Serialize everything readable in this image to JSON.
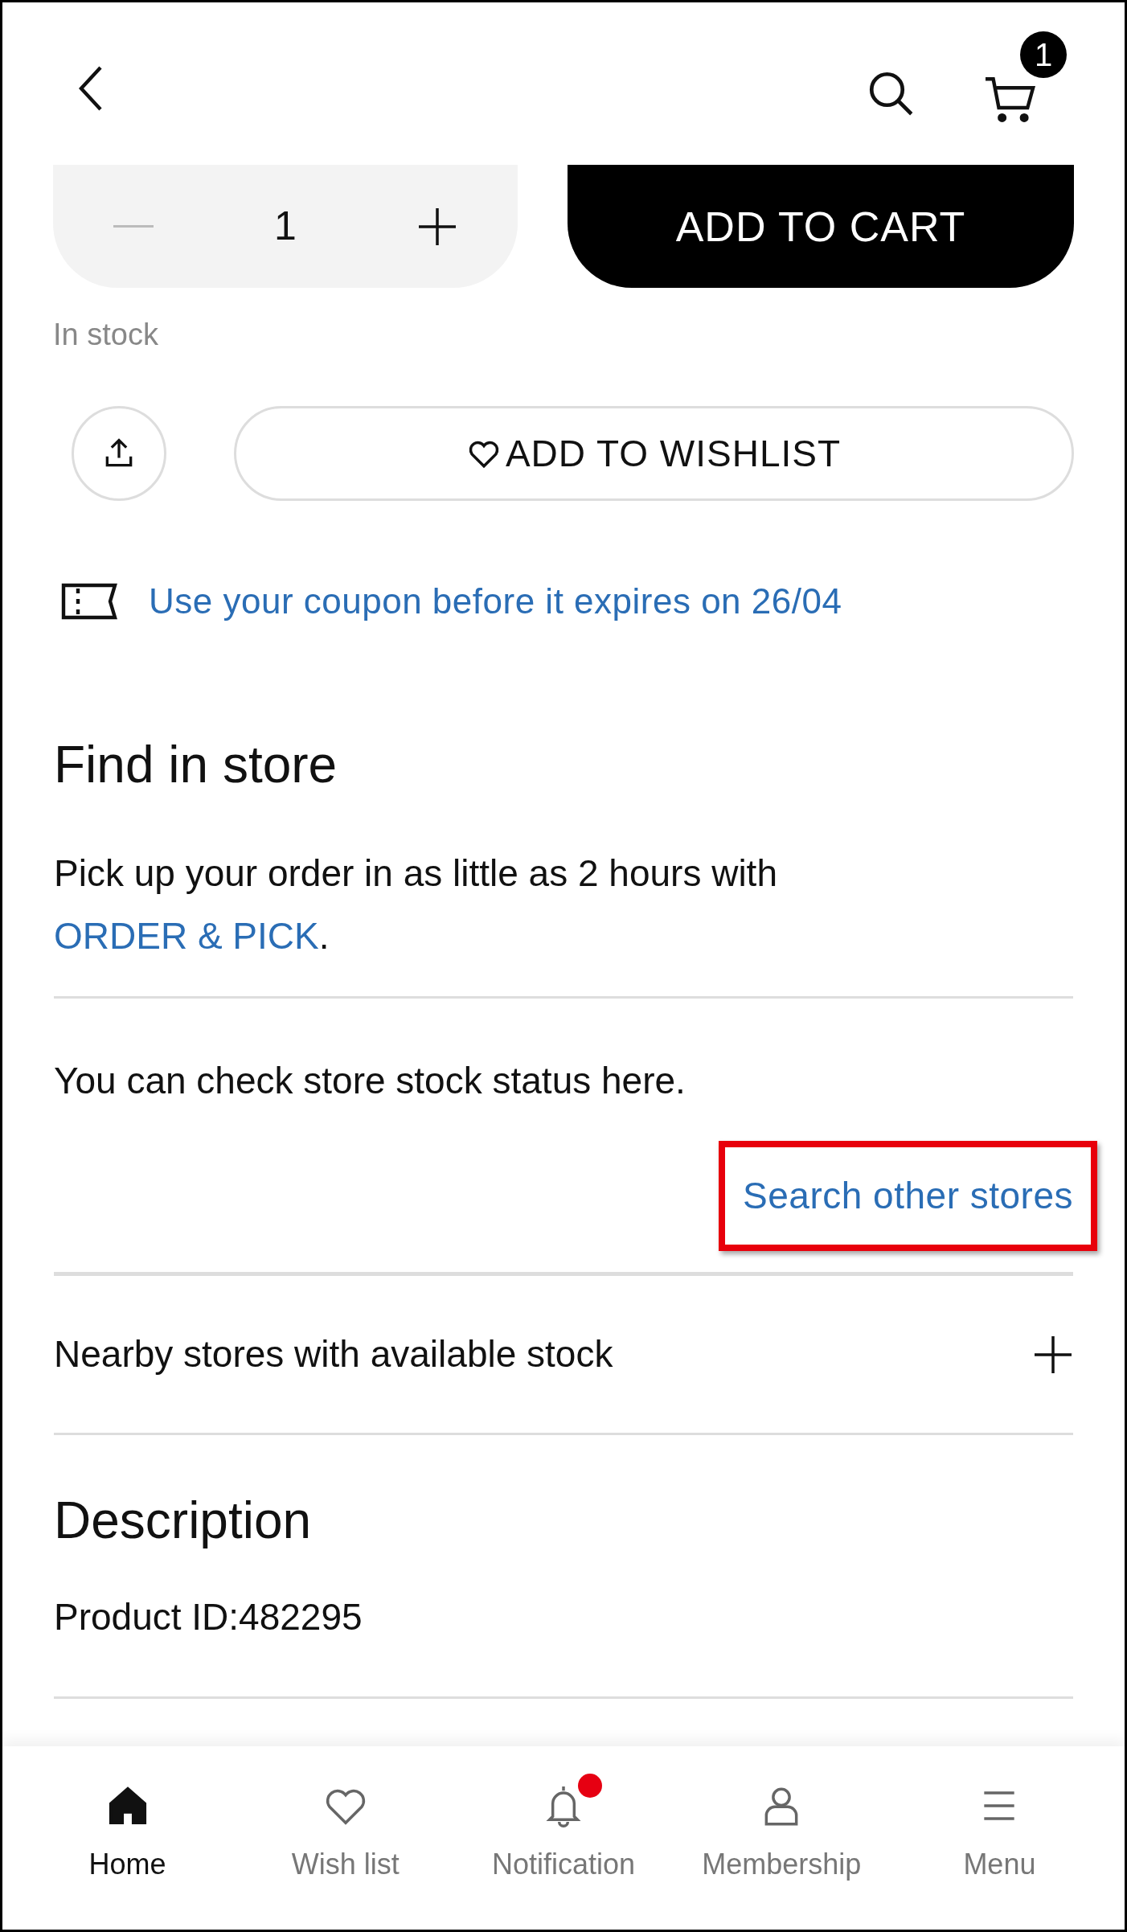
{
  "header": {
    "cart_badge": "1"
  },
  "purchase": {
    "quantity": "1",
    "decrease_disabled": true,
    "add_to_cart": "ADD TO CART",
    "stock_status": "In stock",
    "wishlist_button": "ADD TO WISHLIST"
  },
  "coupon": {
    "text": "Use your coupon before it expires on 26/04"
  },
  "find_in_store": {
    "title": "Find in store",
    "description": "Pick up your order in as little as 2 hours with",
    "link": "ORDER & PICK",
    "suffix": ".",
    "stock_note": "You can check store stock status here.",
    "search_link": {
      "label": "Search other stores",
      "highlighted": true
    }
  },
  "accordion": [
    {
      "label": "Nearby stores with available stock",
      "expanded": false
    }
  ],
  "description": {
    "title": "Description",
    "product_id": "Product ID:482295"
  },
  "bottom_nav": [
    {
      "label": "Home",
      "kind": "home",
      "selected": true,
      "badge": false
    },
    {
      "label": "Wish list",
      "kind": "heart",
      "selected": false,
      "badge": false
    },
    {
      "label": "Notification",
      "kind": "bell",
      "selected": false,
      "badge": true
    },
    {
      "label": "Membership",
      "kind": "person",
      "selected": false,
      "badge": false
    },
    {
      "label": "Menu",
      "kind": "menu",
      "selected": false,
      "badge": false
    }
  ]
}
